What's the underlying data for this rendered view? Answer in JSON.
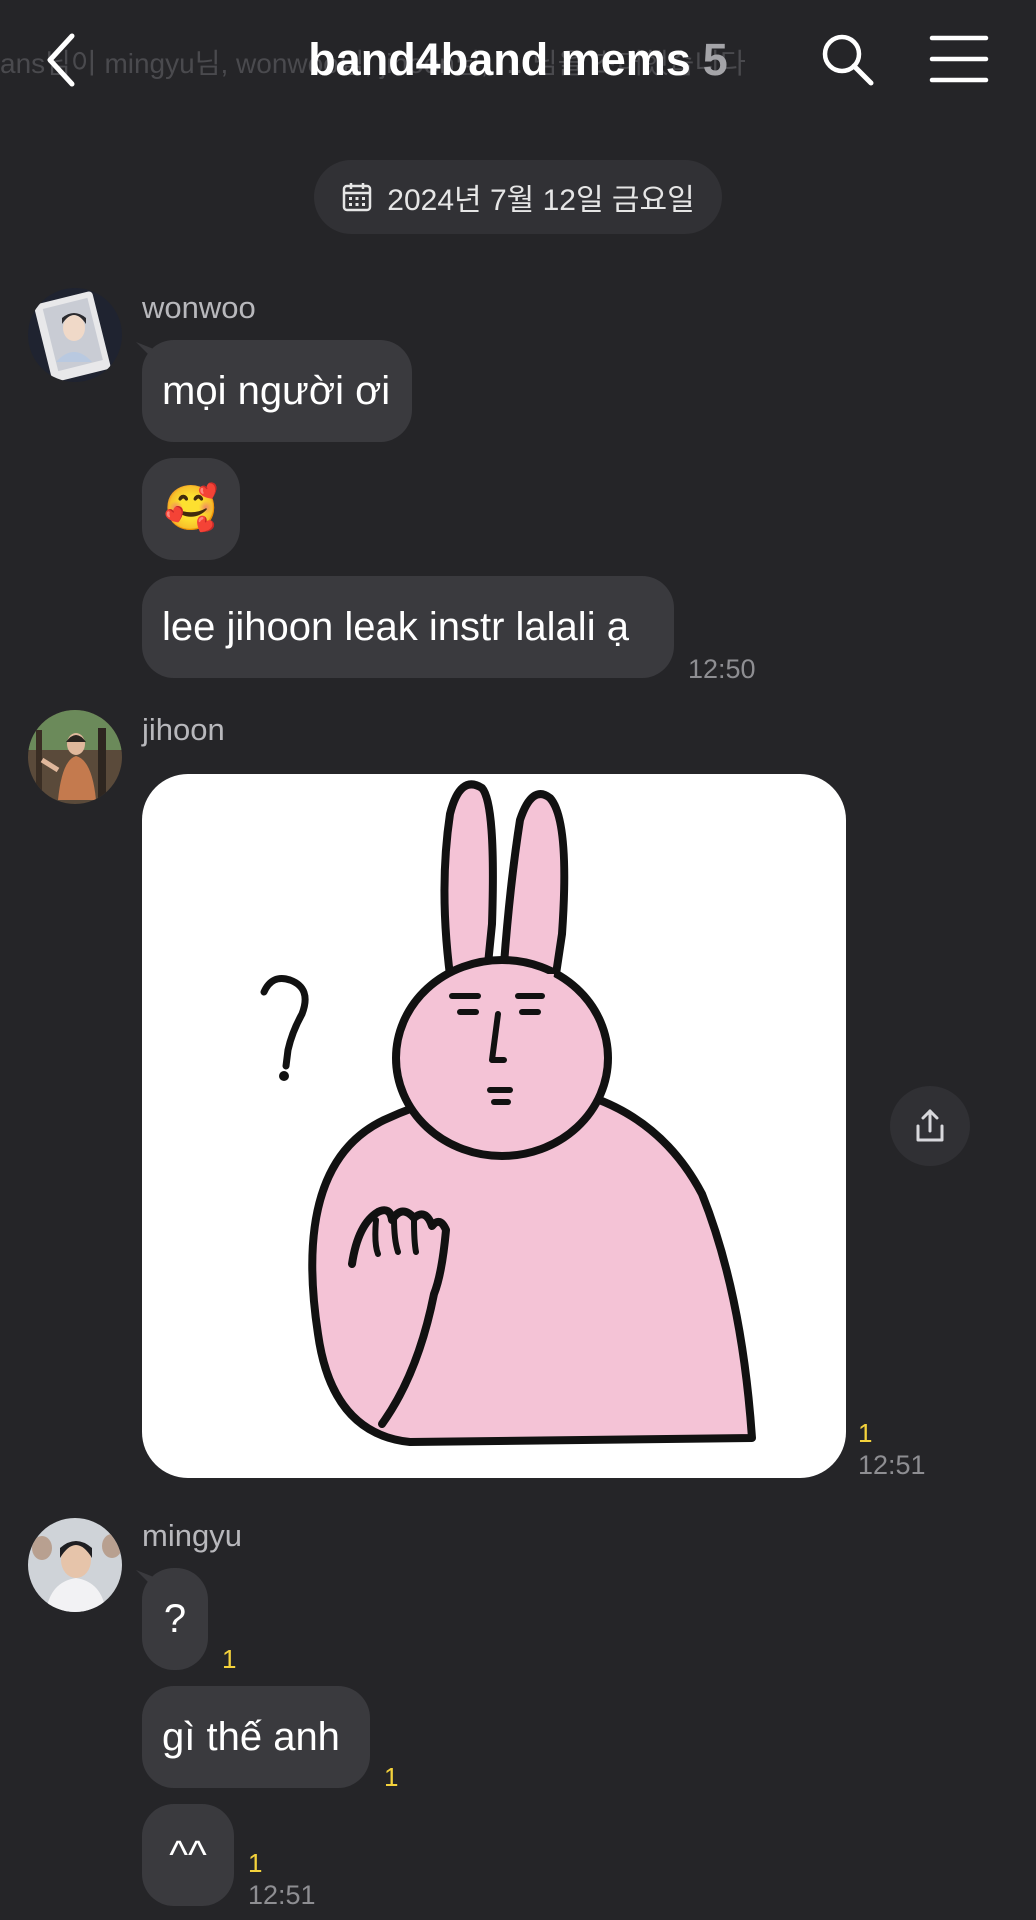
{
  "header": {
    "marquee": "ans님이 mingyu님, wonwoo님, jihoon님, … 님을 초대했습니다",
    "title": "band4band mems",
    "member_count": "5"
  },
  "date_divider": "2024년 7월 12일 금요일",
  "messages": {
    "wonwoo": {
      "sender": "wonwoo",
      "bubbles": [
        "mọi người ơi",
        "🥰",
        "lee jihoon leak instr lalali ạ"
      ],
      "time": "12:50"
    },
    "jihoon": {
      "sender": "jihoon",
      "sticker": "pink-rabbit-question-sticker",
      "unread": "1",
      "time": "12:51"
    },
    "mingyu": {
      "sender": "mingyu",
      "bubbles": [
        "?",
        "gì thế anh",
        "^^"
      ],
      "unread": [
        "1",
        "1",
        "1"
      ],
      "time": "12:51"
    }
  },
  "colors": {
    "background": "#252528",
    "bubble": "#3a3a3e",
    "unread": "#f4d23c",
    "sticker_pink": "#f4c3d6"
  }
}
